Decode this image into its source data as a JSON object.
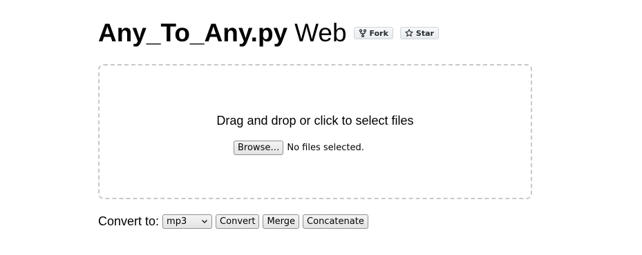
{
  "header": {
    "title_bold": "Any_To_Any.py",
    "title_light": "Web",
    "fork_label": "Fork",
    "star_label": "Star",
    "fork_icon": "fork-icon",
    "star_icon": "star-icon"
  },
  "dropzone": {
    "prompt": "Drag and drop or click to select files",
    "browse_label": "Browse…",
    "file_status": "No files selected."
  },
  "convert": {
    "label": "Convert to:",
    "format_selected": "mp3",
    "convert_label": "Convert",
    "merge_label": "Merge",
    "concatenate_label": "Concatenate"
  },
  "colors": {
    "dropzone_border": "#c8c8c8",
    "button_text": "#24292f"
  }
}
